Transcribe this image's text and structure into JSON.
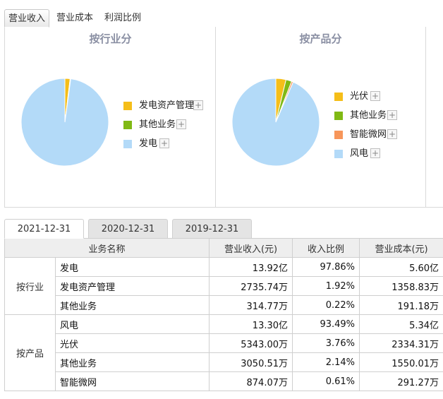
{
  "tabs": [
    {
      "label": "营业收入",
      "active": true
    },
    {
      "label": "营业成本",
      "active": false
    },
    {
      "label": "利润比例",
      "active": false
    }
  ],
  "chart_data": [
    {
      "type": "pie",
      "title": "按行业分",
      "labels": [
        "发电资产管理",
        "其他业务",
        "发电"
      ],
      "values": [
        1.92,
        0.22,
        97.86
      ],
      "colors": [
        "#f5be19",
        "#80b914",
        "#b3daf8"
      ],
      "legend": "right"
    },
    {
      "type": "pie",
      "title": "按产品分",
      "labels": [
        "光伏",
        "其他业务",
        "智能微网",
        "风电"
      ],
      "values": [
        3.76,
        2.14,
        0.61,
        93.49
      ],
      "colors": [
        "#f5be19",
        "#80b914",
        "#f7965a",
        "#b3daf8"
      ],
      "legend": "right"
    }
  ],
  "legend_plus": "+",
  "date_tabs": [
    {
      "label": "2021-12-31",
      "active": true
    },
    {
      "label": "2020-12-31",
      "active": false
    },
    {
      "label": "2019-12-31",
      "active": false
    }
  ],
  "table": {
    "headers": [
      "业务名称",
      "营业收入(元)",
      "收入比例",
      "营业成本(元)"
    ],
    "groups": [
      {
        "name": "按行业",
        "rows": [
          {
            "name": "发电",
            "revenue": "13.92亿",
            "ratio": "97.86%",
            "cost": "5.60亿"
          },
          {
            "name": "发电资产管理",
            "revenue": "2735.74万",
            "ratio": "1.92%",
            "cost": "1358.83万"
          },
          {
            "name": "其他业务",
            "revenue": "314.77万",
            "ratio": "0.22%",
            "cost": "191.18万"
          }
        ]
      },
      {
        "name": "按产品",
        "rows": [
          {
            "name": "风电",
            "revenue": "13.30亿",
            "ratio": "93.49%",
            "cost": "5.34亿"
          },
          {
            "name": "光伏",
            "revenue": "5343.00万",
            "ratio": "3.76%",
            "cost": "2334.31万"
          },
          {
            "name": "其他业务",
            "revenue": "3050.51万",
            "ratio": "2.14%",
            "cost": "1550.01万"
          },
          {
            "name": "智能微网",
            "revenue": "874.07万",
            "ratio": "0.61%",
            "cost": "291.27万"
          }
        ]
      }
    ]
  }
}
